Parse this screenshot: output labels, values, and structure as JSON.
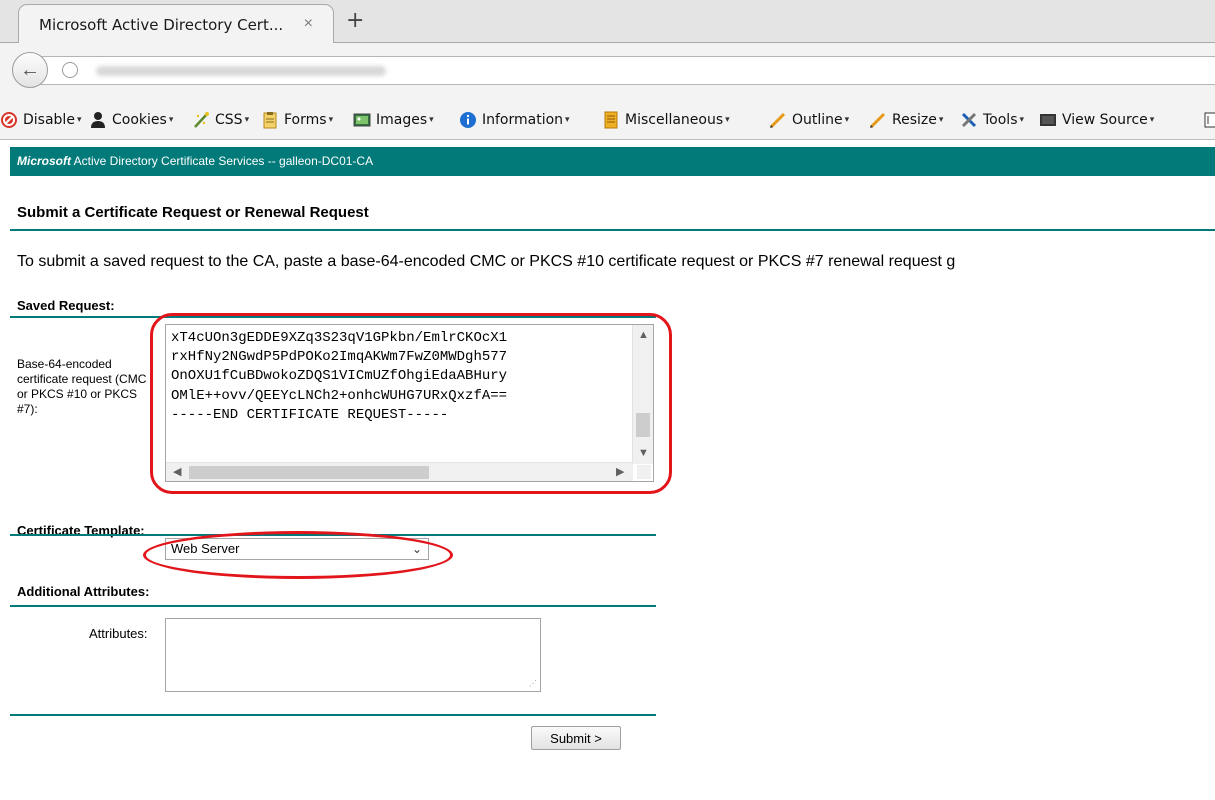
{
  "browser": {
    "tab_title": "Microsoft Active Directory Cert...",
    "tab_close": "×",
    "new_tab": "+",
    "back": "←"
  },
  "devbar": {
    "items": [
      {
        "label": "Disable",
        "icon": "disable-icon"
      },
      {
        "label": "Cookies",
        "icon": "cookies-icon"
      },
      {
        "label": "CSS",
        "icon": "css-icon"
      },
      {
        "label": "Forms",
        "icon": "forms-icon"
      },
      {
        "label": "Images",
        "icon": "images-icon"
      },
      {
        "label": "Information",
        "icon": "information-icon"
      },
      {
        "label": "Miscellaneous",
        "icon": "miscellaneous-icon"
      },
      {
        "label": "Outline",
        "icon": "outline-icon"
      },
      {
        "label": "Resize",
        "icon": "resize-icon"
      },
      {
        "label": "Tools",
        "icon": "tools-icon"
      },
      {
        "label": "View Source",
        "icon": "view-source-icon"
      }
    ],
    "caret": "▾"
  },
  "header": {
    "brand": "Microsoft",
    "title": " Active Directory Certificate Services  --  galleon-DC01-CA"
  },
  "page": {
    "title": "Submit a Certificate Request or Renewal Request",
    "intro": "To submit a saved request to the CA, paste a base-64-encoded CMC or PKCS #10 certificate request or PKCS #7 renewal request g"
  },
  "saved_request": {
    "section_label": "Saved Request:",
    "field_description": "Base-64-encoded certificate request (CMC or PKCS #10 or PKCS #7):",
    "lines": [
      "xT4cUOn3gEDDE9XZq3S23qV1GPkbn/EmlrCKOcX1",
      "rxHfNy2NGwdP5PdPOKo2ImqAKWm7FwZ0MWDgh577",
      "OnOXU1fCuBDwokoZDQS1VICmUZfOhgiEdaABHury",
      "OMlE++ovv/QEEYcLNCh2+onhcWUHG7URxQxzfA==",
      "-----END CERTIFICATE REQUEST-----"
    ]
  },
  "certificate_template": {
    "section_label": "Certificate Template:",
    "selected": "Web Server",
    "chevron": "⌄"
  },
  "additional_attributes": {
    "section_label": "Additional Attributes:",
    "field_label": "Attributes:",
    "value": ""
  },
  "actions": {
    "submit_label": "Submit >"
  },
  "colors": {
    "header_teal": "#017a79",
    "highlight_red": "#e2151b"
  }
}
